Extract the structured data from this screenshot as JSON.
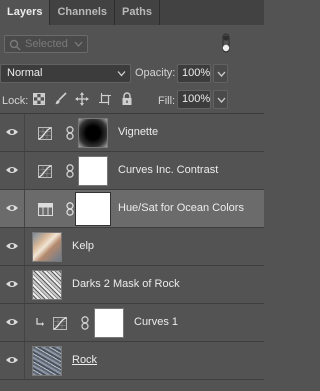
{
  "tabs": [
    {
      "label": "Layers"
    },
    {
      "label": "Channels"
    },
    {
      "label": "Paths"
    }
  ],
  "filter": {
    "placeholder": "Selected"
  },
  "blend": {
    "mode": "Normal"
  },
  "opacity": {
    "label": "Opacity:",
    "value": "100%"
  },
  "lock": {
    "label": "Lock:"
  },
  "fill": {
    "label": "Fill:",
    "value": "100%"
  },
  "layers": [
    {
      "name": "Vignette",
      "type": "curves"
    },
    {
      "name": "Curves Inc. Contrast",
      "type": "curves"
    },
    {
      "name": "Hue/Sat for Ocean Colors",
      "type": "huesat",
      "selected": true
    },
    {
      "name": "Kelp",
      "type": "image"
    },
    {
      "name": "Darks 2 Mask of Rock",
      "type": "image"
    },
    {
      "name": "Curves 1",
      "type": "curves",
      "clipped": true
    },
    {
      "name": "Rock",
      "type": "image"
    }
  ]
}
